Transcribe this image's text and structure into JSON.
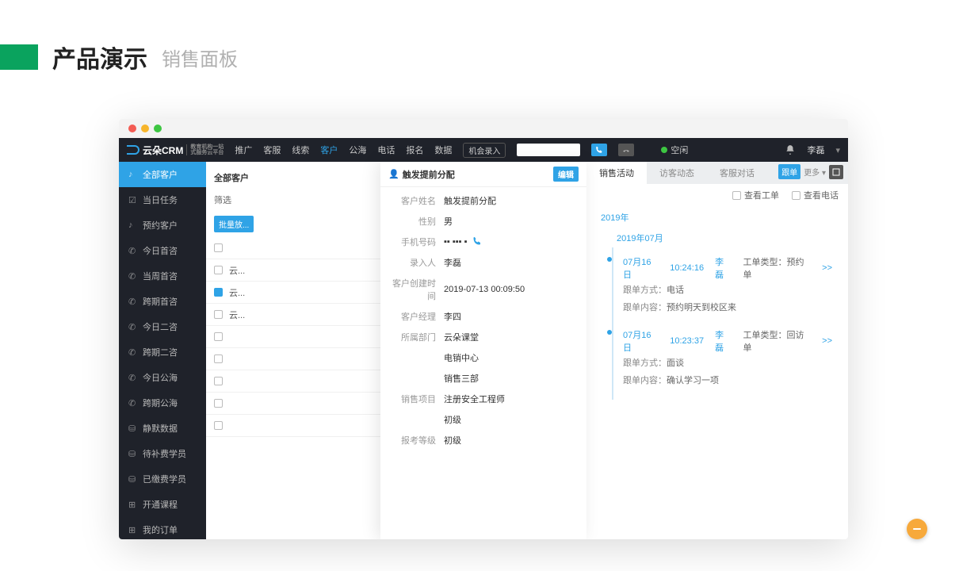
{
  "slide": {
    "title": "产品演示",
    "subtitle": "销售面板"
  },
  "logo": {
    "text": "云朵CRM",
    "sub1": "教育机构一站",
    "sub2": "式服务云平台"
  },
  "nav": {
    "items": [
      "推广",
      "客服",
      "线索",
      "客户",
      "公海",
      "电话",
      "报名",
      "数据"
    ],
    "activeIndex": 3,
    "opportunityBtn": "机会录入",
    "statusText": "空闲",
    "userName": "李磊"
  },
  "sidebar": {
    "head": "全部客户",
    "items": [
      {
        "icon": "☑",
        "label": "当日任务"
      },
      {
        "icon": "♪",
        "label": "预约客户"
      },
      {
        "icon": "✆",
        "label": "今日首咨"
      },
      {
        "icon": "✆",
        "label": "当周首咨"
      },
      {
        "icon": "✆",
        "label": "跨期首咨"
      },
      {
        "icon": "✆",
        "label": "今日二咨"
      },
      {
        "icon": "✆",
        "label": "跨期二咨"
      },
      {
        "icon": "✆",
        "label": "今日公海"
      },
      {
        "icon": "✆",
        "label": "跨期公海"
      },
      {
        "icon": "⛁",
        "label": "静默数据"
      },
      {
        "icon": "⛁",
        "label": "待补费学员"
      },
      {
        "icon": "⛁",
        "label": "已缴费学员"
      },
      {
        "icon": "⊞",
        "label": "开通课程"
      },
      {
        "icon": "⊞",
        "label": "我的订单"
      }
    ]
  },
  "list": {
    "title": "全部客户",
    "filterLabel": "筛选",
    "batchBtn": "批量放...",
    "rows": [
      "云...",
      "云...",
      "云...",
      "",
      "",
      "",
      "",
      ""
    ],
    "checkedIndex": 1
  },
  "detail": {
    "head": "触发提前分配",
    "editBtn": "编辑",
    "fields": [
      {
        "k": "客户姓名",
        "v": "触发提前分配"
      },
      {
        "k": "性别",
        "v": "男"
      },
      {
        "k": "手机号码",
        "v": "▪▪ ▪▪▪ ▪",
        "phone": true
      },
      {
        "k": "录入人",
        "v": "李磊"
      },
      {
        "k": "客户创建时间",
        "v": "2019-07-13 00:09:50"
      },
      {
        "k": "客户经理",
        "v": "李四"
      },
      {
        "k": "所属部门",
        "v": "云朵课堂"
      },
      {
        "k": "",
        "v": "电销中心"
      },
      {
        "k": "",
        "v": "销售三部"
      },
      {
        "k": "销售项目",
        "v": "注册安全工程师"
      },
      {
        "k": "",
        "v": "初级"
      },
      {
        "k": "报考等级",
        "v": "初级"
      }
    ]
  },
  "activity": {
    "tabs": [
      "销售活动",
      "访客动态",
      "客服对话"
    ],
    "activeIndex": 0,
    "trackBtn": "跟单",
    "moreBtn": "更多 ▾",
    "filters": [
      {
        "label": "查看工单"
      },
      {
        "label": "查看电话"
      }
    ],
    "yearLabel": "2019年",
    "monthLabel": "2019年07月",
    "cards": [
      {
        "date": "07月16日",
        "time": "10:24:16",
        "person": "李磊",
        "typeLabel": "工单类型：",
        "typeValue": "预约单",
        "more": ">>",
        "lines": [
          {
            "k": "跟单方式：",
            "v": "电话"
          },
          {
            "k": "跟单内容：",
            "v": "预约明天到校区来"
          }
        ]
      },
      {
        "date": "07月16日",
        "time": "10:23:37",
        "person": "李磊",
        "typeLabel": "工单类型：",
        "typeValue": "回访单",
        "more": ">>",
        "lines": [
          {
            "k": "跟单方式：",
            "v": "面谈"
          },
          {
            "k": "跟单内容：",
            "v": "确认学习一项"
          }
        ]
      }
    ]
  }
}
